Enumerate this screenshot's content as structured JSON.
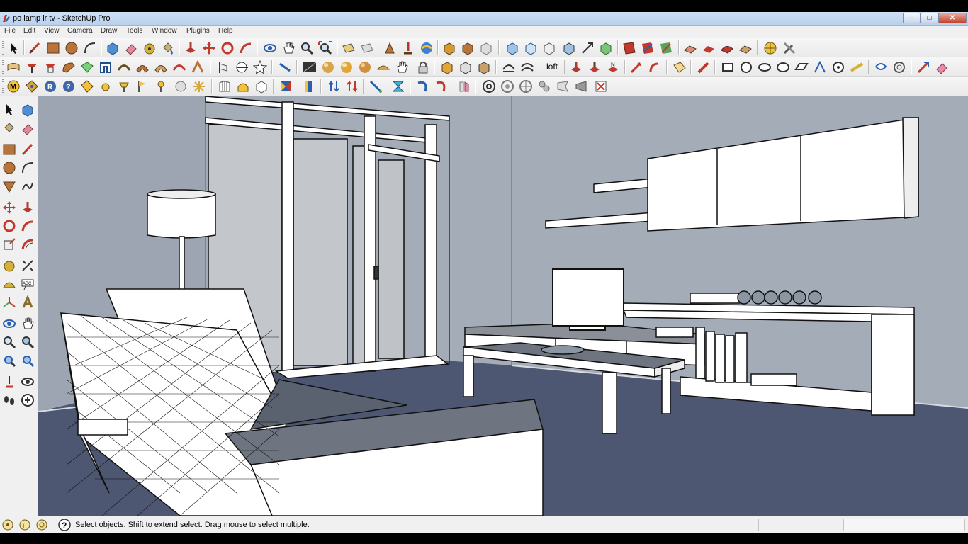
{
  "window": {
    "title": "po lamp ir tv - SketchUp Pro",
    "min_glyph": "–",
    "max_glyph": "□",
    "close_glyph": "✕"
  },
  "menu": {
    "items": [
      "File",
      "Edit",
      "View",
      "Camera",
      "Draw",
      "Tools",
      "Window",
      "Plugins",
      "Help"
    ]
  },
  "toolbar": {
    "loft_label": "loft"
  },
  "status": {
    "text": "Select objects. Shift to extend select. Drag mouse to select multiple.",
    "measurements_value": ""
  },
  "colors": {
    "wall": "#a3acb7",
    "floor": "#4e5772",
    "furniture": "#ffffff",
    "edge": "#111111",
    "ceiling": "#b9c0c9"
  }
}
